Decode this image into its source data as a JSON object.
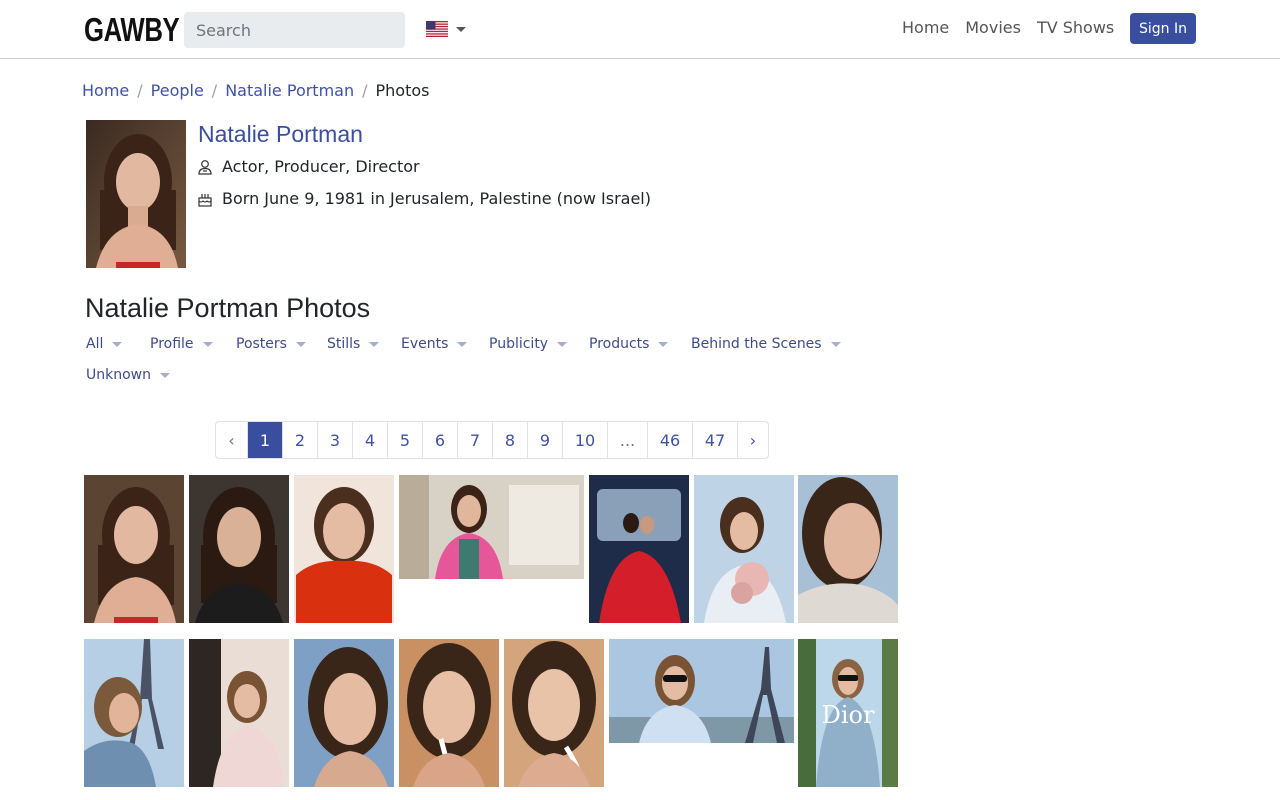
{
  "navbar": {
    "logo": "GAWBY",
    "search_placeholder": "Search",
    "links": [
      "Home",
      "Movies",
      "TV Shows"
    ],
    "signin_label": "Sign In"
  },
  "breadcrumb": {
    "items": [
      "Home",
      "People",
      "Natalie Portman"
    ],
    "current": "Photos"
  },
  "person": {
    "name": "Natalie Portman",
    "roles": "Actor, Producer, Director",
    "born": "Born June 9, 1981 in Jerusalem, Palestine (now Israel)"
  },
  "photos": {
    "title": "Natalie Portman Photos",
    "filters": [
      "All",
      "Profile",
      "Posters",
      "Stills",
      "Events",
      "Publicity",
      "Products",
      "Behind the Scenes",
      "Unknown"
    ]
  },
  "pagination": {
    "prev": "‹",
    "pages": [
      "1",
      "2",
      "3",
      "4",
      "5",
      "6",
      "7",
      "8",
      "9",
      "10",
      "...",
      "46",
      "47"
    ],
    "next": "›",
    "active_page": "1"
  },
  "icons": {
    "language_flag": "us-flag-icon",
    "roles_icon": "person-icon",
    "born_icon": "cake-icon"
  },
  "colors": {
    "accent": "#3a4ea0",
    "link": "#3f51a5"
  },
  "thumbnails": {
    "watermark": "Dior"
  }
}
